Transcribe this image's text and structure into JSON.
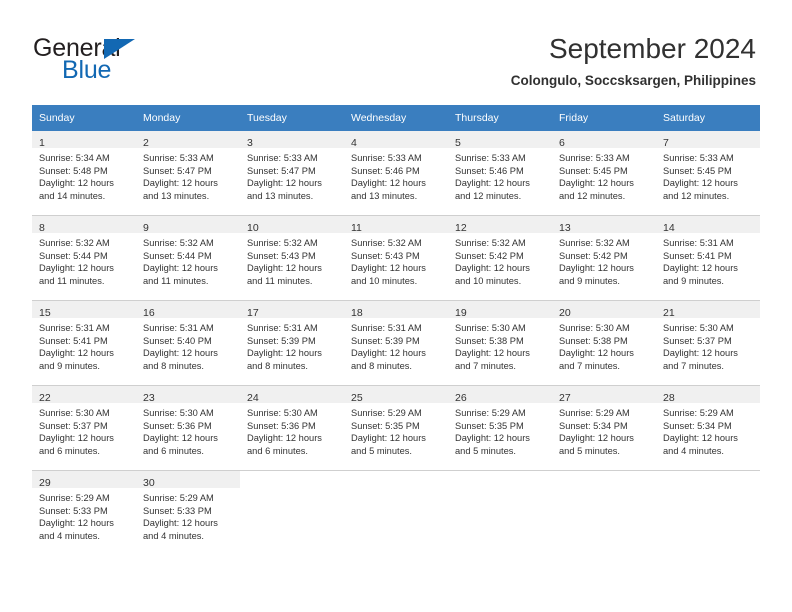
{
  "brand": {
    "name_part1": "General",
    "name_part2": "Blue",
    "triangle_icon": "triangle-icon",
    "color_dark": "#231f20",
    "color_blue": "#1268b3"
  },
  "header": {
    "title": "September 2024",
    "subtitle": "Colongulo, Soccsksargen, Philippines"
  },
  "theme": {
    "header_row_bg": "#3a7ebf",
    "daynum_band_bg": "#f0f0f0",
    "grid_line": "#cfcfcf",
    "text": "#333333"
  },
  "weekday_headers": [
    "Sunday",
    "Monday",
    "Tuesday",
    "Wednesday",
    "Thursday",
    "Friday",
    "Saturday"
  ],
  "weeks": [
    [
      {
        "day": "1",
        "sunrise": "Sunrise: 5:34 AM",
        "sunset": "Sunset: 5:48 PM",
        "daylight1": "Daylight: 12 hours",
        "daylight2": "and 14 minutes."
      },
      {
        "day": "2",
        "sunrise": "Sunrise: 5:33 AM",
        "sunset": "Sunset: 5:47 PM",
        "daylight1": "Daylight: 12 hours",
        "daylight2": "and 13 minutes."
      },
      {
        "day": "3",
        "sunrise": "Sunrise: 5:33 AM",
        "sunset": "Sunset: 5:47 PM",
        "daylight1": "Daylight: 12 hours",
        "daylight2": "and 13 minutes."
      },
      {
        "day": "4",
        "sunrise": "Sunrise: 5:33 AM",
        "sunset": "Sunset: 5:46 PM",
        "daylight1": "Daylight: 12 hours",
        "daylight2": "and 13 minutes."
      },
      {
        "day": "5",
        "sunrise": "Sunrise: 5:33 AM",
        "sunset": "Sunset: 5:46 PM",
        "daylight1": "Daylight: 12 hours",
        "daylight2": "and 12 minutes."
      },
      {
        "day": "6",
        "sunrise": "Sunrise: 5:33 AM",
        "sunset": "Sunset: 5:45 PM",
        "daylight1": "Daylight: 12 hours",
        "daylight2": "and 12 minutes."
      },
      {
        "day": "7",
        "sunrise": "Sunrise: 5:33 AM",
        "sunset": "Sunset: 5:45 PM",
        "daylight1": "Daylight: 12 hours",
        "daylight2": "and 12 minutes."
      }
    ],
    [
      {
        "day": "8",
        "sunrise": "Sunrise: 5:32 AM",
        "sunset": "Sunset: 5:44 PM",
        "daylight1": "Daylight: 12 hours",
        "daylight2": "and 11 minutes."
      },
      {
        "day": "9",
        "sunrise": "Sunrise: 5:32 AM",
        "sunset": "Sunset: 5:44 PM",
        "daylight1": "Daylight: 12 hours",
        "daylight2": "and 11 minutes."
      },
      {
        "day": "10",
        "sunrise": "Sunrise: 5:32 AM",
        "sunset": "Sunset: 5:43 PM",
        "daylight1": "Daylight: 12 hours",
        "daylight2": "and 11 minutes."
      },
      {
        "day": "11",
        "sunrise": "Sunrise: 5:32 AM",
        "sunset": "Sunset: 5:43 PM",
        "daylight1": "Daylight: 12 hours",
        "daylight2": "and 10 minutes."
      },
      {
        "day": "12",
        "sunrise": "Sunrise: 5:32 AM",
        "sunset": "Sunset: 5:42 PM",
        "daylight1": "Daylight: 12 hours",
        "daylight2": "and 10 minutes."
      },
      {
        "day": "13",
        "sunrise": "Sunrise: 5:32 AM",
        "sunset": "Sunset: 5:42 PM",
        "daylight1": "Daylight: 12 hours",
        "daylight2": "and 9 minutes."
      },
      {
        "day": "14",
        "sunrise": "Sunrise: 5:31 AM",
        "sunset": "Sunset: 5:41 PM",
        "daylight1": "Daylight: 12 hours",
        "daylight2": "and 9 minutes."
      }
    ],
    [
      {
        "day": "15",
        "sunrise": "Sunrise: 5:31 AM",
        "sunset": "Sunset: 5:41 PM",
        "daylight1": "Daylight: 12 hours",
        "daylight2": "and 9 minutes."
      },
      {
        "day": "16",
        "sunrise": "Sunrise: 5:31 AM",
        "sunset": "Sunset: 5:40 PM",
        "daylight1": "Daylight: 12 hours",
        "daylight2": "and 8 minutes."
      },
      {
        "day": "17",
        "sunrise": "Sunrise: 5:31 AM",
        "sunset": "Sunset: 5:39 PM",
        "daylight1": "Daylight: 12 hours",
        "daylight2": "and 8 minutes."
      },
      {
        "day": "18",
        "sunrise": "Sunrise: 5:31 AM",
        "sunset": "Sunset: 5:39 PM",
        "daylight1": "Daylight: 12 hours",
        "daylight2": "and 8 minutes."
      },
      {
        "day": "19",
        "sunrise": "Sunrise: 5:30 AM",
        "sunset": "Sunset: 5:38 PM",
        "daylight1": "Daylight: 12 hours",
        "daylight2": "and 7 minutes."
      },
      {
        "day": "20",
        "sunrise": "Sunrise: 5:30 AM",
        "sunset": "Sunset: 5:38 PM",
        "daylight1": "Daylight: 12 hours",
        "daylight2": "and 7 minutes."
      },
      {
        "day": "21",
        "sunrise": "Sunrise: 5:30 AM",
        "sunset": "Sunset: 5:37 PM",
        "daylight1": "Daylight: 12 hours",
        "daylight2": "and 7 minutes."
      }
    ],
    [
      {
        "day": "22",
        "sunrise": "Sunrise: 5:30 AM",
        "sunset": "Sunset: 5:37 PM",
        "daylight1": "Daylight: 12 hours",
        "daylight2": "and 6 minutes."
      },
      {
        "day": "23",
        "sunrise": "Sunrise: 5:30 AM",
        "sunset": "Sunset: 5:36 PM",
        "daylight1": "Daylight: 12 hours",
        "daylight2": "and 6 minutes."
      },
      {
        "day": "24",
        "sunrise": "Sunrise: 5:30 AM",
        "sunset": "Sunset: 5:36 PM",
        "daylight1": "Daylight: 12 hours",
        "daylight2": "and 6 minutes."
      },
      {
        "day": "25",
        "sunrise": "Sunrise: 5:29 AM",
        "sunset": "Sunset: 5:35 PM",
        "daylight1": "Daylight: 12 hours",
        "daylight2": "and 5 minutes."
      },
      {
        "day": "26",
        "sunrise": "Sunrise: 5:29 AM",
        "sunset": "Sunset: 5:35 PM",
        "daylight1": "Daylight: 12 hours",
        "daylight2": "and 5 minutes."
      },
      {
        "day": "27",
        "sunrise": "Sunrise: 5:29 AM",
        "sunset": "Sunset: 5:34 PM",
        "daylight1": "Daylight: 12 hours",
        "daylight2": "and 5 minutes."
      },
      {
        "day": "28",
        "sunrise": "Sunrise: 5:29 AM",
        "sunset": "Sunset: 5:34 PM",
        "daylight1": "Daylight: 12 hours",
        "daylight2": "and 4 minutes."
      }
    ],
    [
      {
        "day": "29",
        "sunrise": "Sunrise: 5:29 AM",
        "sunset": "Sunset: 5:33 PM",
        "daylight1": "Daylight: 12 hours",
        "daylight2": "and 4 minutes."
      },
      {
        "day": "30",
        "sunrise": "Sunrise: 5:29 AM",
        "sunset": "Sunset: 5:33 PM",
        "daylight1": "Daylight: 12 hours",
        "daylight2": "and 4 minutes."
      },
      {
        "day": "",
        "sunrise": "",
        "sunset": "",
        "daylight1": "",
        "daylight2": ""
      },
      {
        "day": "",
        "sunrise": "",
        "sunset": "",
        "daylight1": "",
        "daylight2": ""
      },
      {
        "day": "",
        "sunrise": "",
        "sunset": "",
        "daylight1": "",
        "daylight2": ""
      },
      {
        "day": "",
        "sunrise": "",
        "sunset": "",
        "daylight1": "",
        "daylight2": ""
      },
      {
        "day": "",
        "sunrise": "",
        "sunset": "",
        "daylight1": "",
        "daylight2": ""
      }
    ]
  ]
}
